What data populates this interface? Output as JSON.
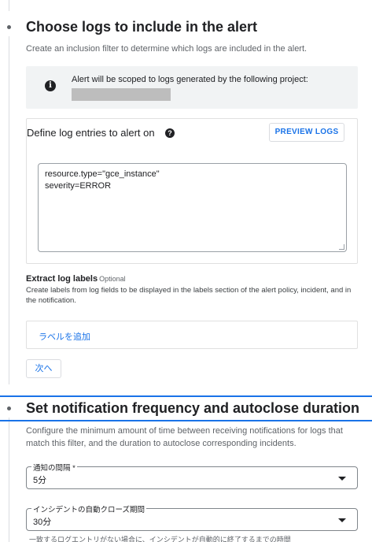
{
  "section1": {
    "title": "Choose logs to include in the alert",
    "description": "Create an inclusion filter to determine which logs are included in the alert.",
    "info_text": "Alert will be scoped to logs generated by the following project:",
    "info_icon": "info-icon"
  },
  "log_entries": {
    "title": "Define log entries to alert on",
    "help_icon": "help-icon",
    "preview_button": "PREVIEW LOGS",
    "query_lines": [
      "resource.type=\"gce_instance\"",
      "severity=ERROR"
    ]
  },
  "extract_labels": {
    "title": "Extract log labels",
    "optional": "Optional",
    "description": "Create labels from log fields to be displayed in the labels section of the alert policy, incident, and in the notification.",
    "add_label": "ラベルを追加"
  },
  "next_button": "次へ",
  "section2": {
    "title": "Set notification frequency and autoclose duration",
    "description": "Configure the minimum amount of time between receiving notifications for logs that match this filter, and the duration to autoclose corresponding incidents.",
    "interval": {
      "label": "通知の間隔 *",
      "value": "5分"
    },
    "autoclose": {
      "label": "インシデントの自動クローズ期間",
      "value": "30分"
    },
    "hint": "一致するログエントリがない場合に、インシデントが自動的に終了するまでの時間"
  },
  "colors": {
    "accent": "#1a73e8",
    "text": "#202124",
    "muted": "#5f6368",
    "info_bg": "#f1f3f4"
  }
}
